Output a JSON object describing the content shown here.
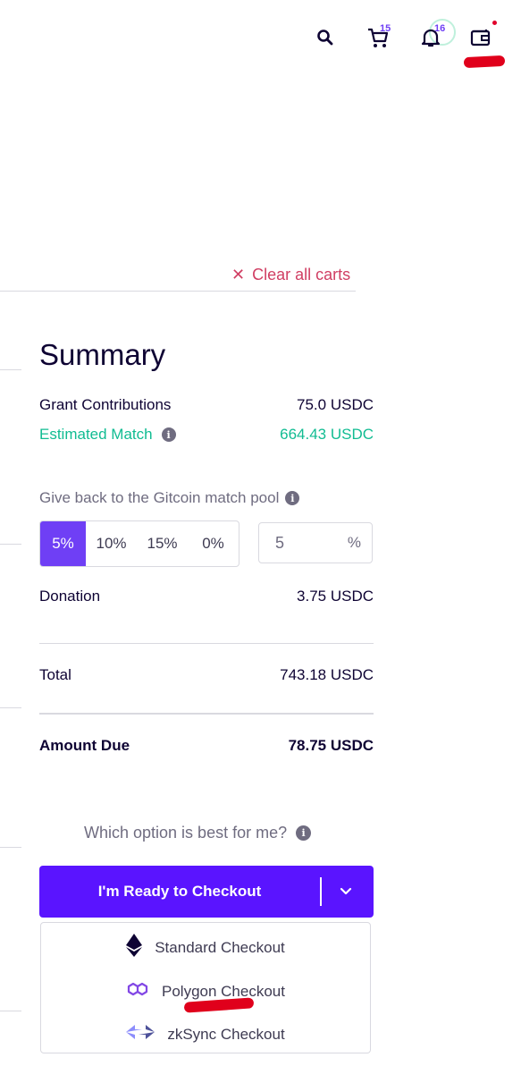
{
  "header": {
    "cart_count": "15",
    "notification_count": "16",
    "icons": [
      "search-icon",
      "cart-icon",
      "bell-icon",
      "wallet-icon"
    ]
  },
  "clear_carts": "Clear all carts",
  "summary": {
    "title": "Summary",
    "grant_contributions_label": "Grant Contributions",
    "grant_contributions_value": "75.0 USDC",
    "estimated_match_label": "Estimated Match",
    "estimated_match_value": "664.43 USDC",
    "give_back_label": "Give back to the Gitcoin match pool",
    "percent_options": [
      "5%",
      "10%",
      "15%",
      "0%"
    ],
    "selected_percent": "5%",
    "custom_percent_value": "5",
    "custom_percent_unit": "%",
    "donation_label": "Donation",
    "donation_value": "3.75 USDC",
    "total_label": "Total",
    "total_value": "743.18 USDC",
    "amount_due_label": "Amount Due",
    "amount_due_value": "78.75 USDC"
  },
  "which_option": "Which option is best for me?",
  "checkout": {
    "button_label": "I'm Ready to Checkout",
    "options": [
      {
        "label": "Standard Checkout",
        "icon": "ethereum-icon"
      },
      {
        "label": "Polygon Checkout",
        "icon": "polygon-icon"
      },
      {
        "label": "zkSync Checkout",
        "icon": "zksync-icon"
      }
    ]
  },
  "colors": {
    "primary": "#5a14ff",
    "accent": "#6f3ff5",
    "green": "#11bc92",
    "danger": "#d03e63",
    "annotation_red": "#e0001b"
  }
}
